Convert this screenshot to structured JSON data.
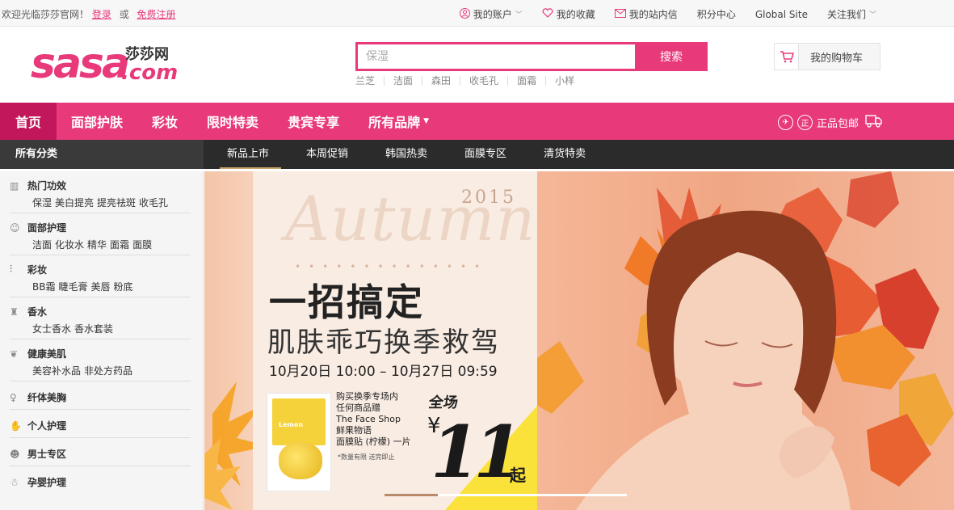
{
  "topbar": {
    "welcome": "欢迎光临莎莎官网！",
    "login": "登录",
    "or": "或",
    "register": "免费注册",
    "links": {
      "account": "我的账户",
      "favorites": "我的收藏",
      "messages": "我的站内信",
      "points": "积分中心",
      "global": "Global Site",
      "follow": "关注我们"
    }
  },
  "header": {
    "logo_word": "sasa",
    "logo_cn": "莎莎网",
    "logo_com": ".com",
    "search": {
      "placeholder": "保湿",
      "button": "搜索"
    },
    "hotwords": [
      "兰芝",
      "洁面",
      "森田",
      "收毛孔",
      "面霜",
      "小样"
    ],
    "cart": "我的购物车"
  },
  "mainnav": {
    "items": [
      "首页",
      "面部护肤",
      "彩妆",
      "限时特卖",
      "贵宾专享",
      "所有品牌"
    ],
    "guarantee": "正品包邮"
  },
  "subbar": {
    "category_title": "所有分类",
    "tabs": [
      "新品上市",
      "本周促销",
      "韩国热卖",
      "面膜专区",
      "清货特卖"
    ]
  },
  "sidebar": {
    "categories": [
      {
        "name": "热门功效",
        "subs": [
          "保湿",
          "美白提亮",
          "提亮祛斑",
          "收毛孔"
        ]
      },
      {
        "name": "面部护理",
        "subs": [
          "洁面",
          "化妆水",
          "精华",
          "面霜",
          "面膜"
        ]
      },
      {
        "name": "彩妆",
        "subs": [
          "BB霜",
          "睫毛膏",
          "美唇",
          "粉底"
        ]
      },
      {
        "name": "香水",
        "subs": [
          "女士香水",
          "香水套装"
        ]
      },
      {
        "name": "健康美肌",
        "subs": [
          "美容补水品",
          "非处方药品"
        ]
      },
      {
        "name": "纤体美胸",
        "subs": []
      },
      {
        "name": "个人护理",
        "subs": []
      },
      {
        "name": "男士专区",
        "subs": []
      },
      {
        "name": "孕婴护理",
        "subs": []
      }
    ]
  },
  "banner": {
    "year": "2015",
    "autumn": "Autumn",
    "headline": "一招搞定",
    "subheadline": "肌肤乖巧换季救驾",
    "time": "10月20日 10:00 – 10月27日 09:59",
    "pack_label": "Lemon",
    "offer_lines": [
      "购买换季专场内",
      "任何商品赠",
      "The Face Shop",
      "鲜果物语",
      "面膜贴 (柠檬) 一片"
    ],
    "note": "*数量有限 送完即止",
    "quan": "全场",
    "yen": "¥",
    "price": "11",
    "qi": "起"
  }
}
